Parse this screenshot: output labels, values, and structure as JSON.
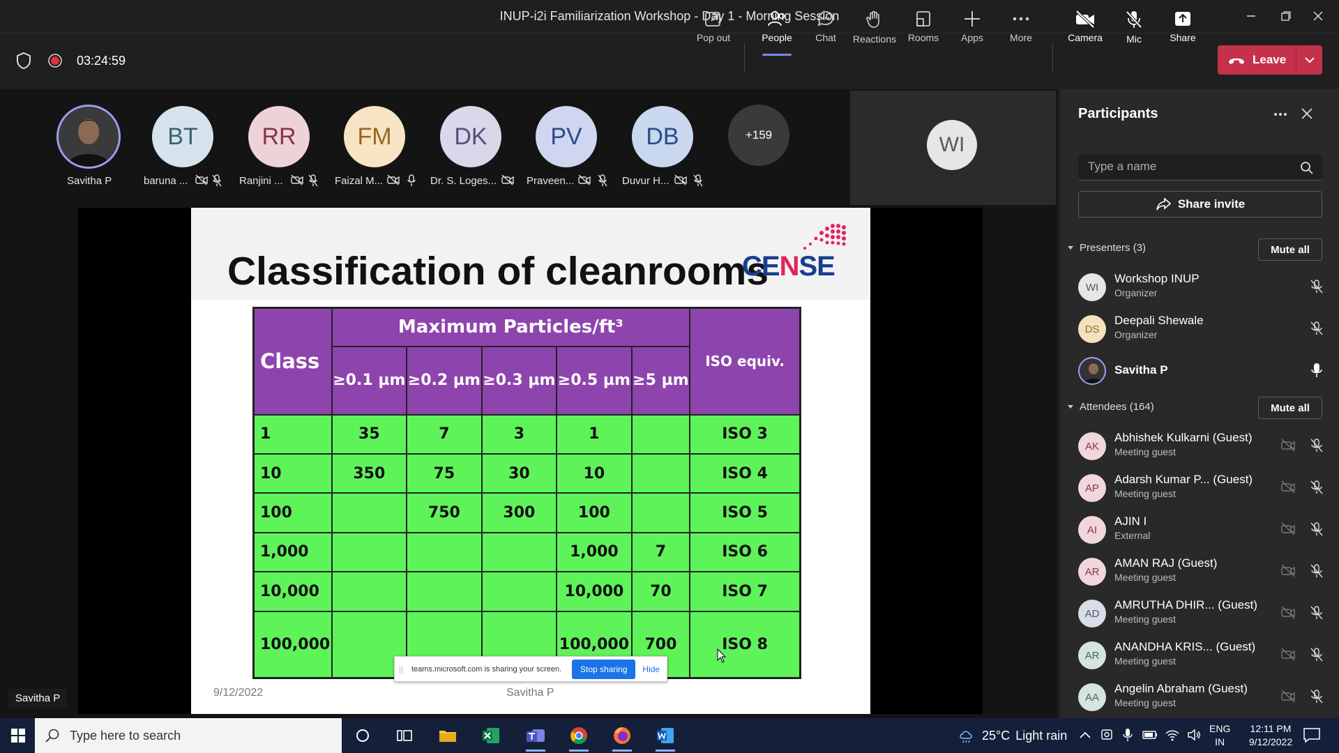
{
  "window": {
    "title": "INUP-i2i Familiarization Workshop - Day 1 - Morning Session"
  },
  "meeting": {
    "timer": "03:24:59"
  },
  "toolbar": {
    "popout": "Pop out",
    "people": "People",
    "chat": "Chat",
    "reactions": "Reactions",
    "rooms": "Rooms",
    "apps": "Apps",
    "more": "More",
    "camera": "Camera",
    "mic": "Mic",
    "share": "Share",
    "leave": "Leave"
  },
  "gallery": {
    "people": [
      {
        "initials": "",
        "name": "Savitha P"
      },
      {
        "initials": "BT",
        "name": "baruna ..."
      },
      {
        "initials": "RR",
        "name": "Ranjini ..."
      },
      {
        "initials": "FM",
        "name": "Faizal M..."
      },
      {
        "initials": "DK",
        "name": "Dr. S. Loges..."
      },
      {
        "initials": "PV",
        "name": "Praveen..."
      },
      {
        "initials": "DB",
        "name": "Duvur H..."
      }
    ],
    "overflow": "+159",
    "tile_initials": "WI"
  },
  "slide": {
    "title": "Classification of cleanrooms",
    "logo_a": "CE",
    "logo_n": "N",
    "logo_b": "SE",
    "header_class": "Class",
    "header_max": "Maximum Particles/ft³",
    "header_iso": "ISO equiv.",
    "subheaders": [
      "≥0.1 µm",
      "≥0.2 µm",
      "≥0.3 µm",
      "≥0.5 µm",
      "≥5 µm"
    ],
    "rows": [
      [
        "1",
        "35",
        "7",
        "3",
        "1",
        "",
        "ISO 3"
      ],
      [
        "10",
        "350",
        "75",
        "30",
        "10",
        "",
        "ISO 4"
      ],
      [
        "100",
        "",
        "750",
        "300",
        "100",
        "",
        "ISO 5"
      ],
      [
        "1,000",
        "",
        "",
        "",
        "1,000",
        "7",
        "ISO 6"
      ],
      [
        "10,000",
        "",
        "",
        "",
        "10,000",
        "70",
        "ISO 7"
      ],
      [
        "100,000",
        "",
        "",
        "",
        "100,000",
        "700",
        "ISO 8"
      ]
    ],
    "date": "9/12/2022",
    "author": "Savitha P"
  },
  "sharebar": {
    "message": "teams.microsoft.com is sharing your screen.",
    "stop": "Stop sharing",
    "hide": "Hide"
  },
  "stage": {
    "speaker_name": "Savitha P"
  },
  "panel": {
    "title": "Participants",
    "search_placeholder": "Type a name",
    "share_invite": "Share invite",
    "presenters_label": "Presenters (3)",
    "attendees_label": "Attendees (164)",
    "mute_all": "Mute all",
    "presenters": [
      {
        "initials": "WI",
        "name": "Workshop INUP",
        "role": "Organizer"
      },
      {
        "initials": "DS",
        "name": "Deepali Shewale",
        "role": "Organizer"
      },
      {
        "initials": "",
        "name": "Savitha P",
        "role": ""
      }
    ],
    "attendees": [
      {
        "initials": "AK",
        "name": "Abhishek Kulkarni (Guest)",
        "role": "Meeting guest"
      },
      {
        "initials": "AP",
        "name": "Adarsh Kumar P...  (Guest)",
        "role": "Meeting guest"
      },
      {
        "initials": "AI",
        "name": "AJIN I",
        "role": "External"
      },
      {
        "initials": "AR",
        "name": "AMAN RAJ (Guest)",
        "role": "Meeting guest"
      },
      {
        "initials": "AD",
        "name": "AMRUTHA DHIR...  (Guest)",
        "role": "Meeting guest"
      },
      {
        "initials": "AR",
        "name": "ANANDHA KRIS...  (Guest)",
        "role": "Meeting guest"
      },
      {
        "initials": "AA",
        "name": "Angelin Abraham (Guest)",
        "role": "Meeting guest"
      }
    ]
  },
  "taskbar": {
    "search_placeholder": "Type here to search",
    "weather_temp": "25°C",
    "weather_text": "Light rain",
    "lang_a": "ENG",
    "lang_b": "IN",
    "time": "12:11 PM",
    "date": "9/12/2022"
  },
  "colors": {
    "leave": "#c4314b",
    "accent": "#7f85f5",
    "table_header": "#8e44ad",
    "table_cell": "#5ff35a"
  }
}
